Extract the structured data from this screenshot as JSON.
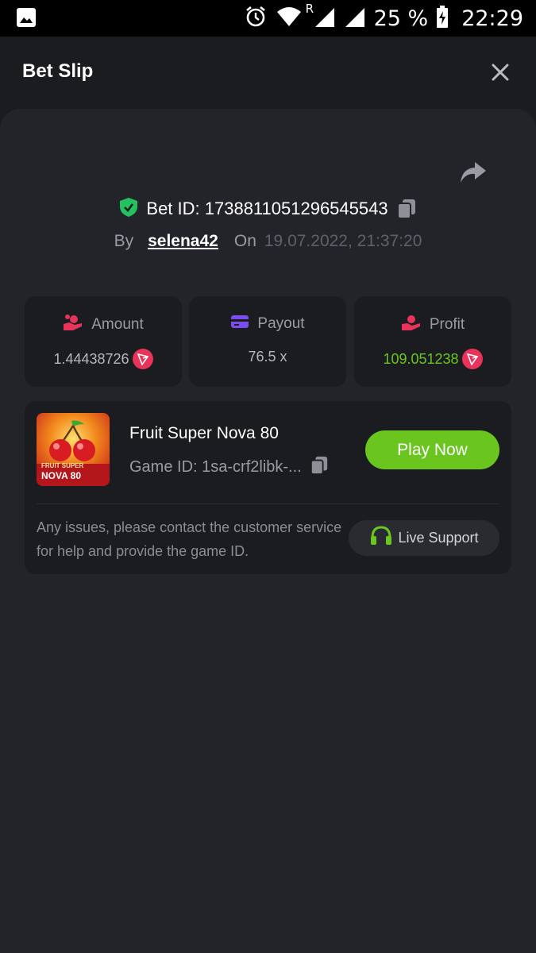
{
  "status_bar": {
    "battery": "25 %",
    "time": "22:29",
    "signal_roaming": "R"
  },
  "header": {
    "title": "Bet Slip"
  },
  "bet": {
    "id_text": "Bet ID: 1738811051296545543",
    "by_label": "By",
    "user": "selena42",
    "on_label": "On",
    "date": "19.07.2022, 21:37:20"
  },
  "stats": {
    "amount": {
      "label": "Amount",
      "value": "1.44438726",
      "icon": "coins-hand-icon"
    },
    "payout": {
      "label": "Payout",
      "value": "76.5 x",
      "icon": "card-icon"
    },
    "profit": {
      "label": "Profit",
      "value": "109.051238",
      "icon": "money-hand-icon"
    }
  },
  "game": {
    "title": "Fruit Super Nova 80",
    "game_id": "Game ID: 1sa-crf2libk-...",
    "play_label": "Play Now",
    "thumb_caption_1": "FRUIT SUPER",
    "thumb_caption_2": "NOVA 80",
    "help_text": "Any issues, please contact the customer service for help and provide the game ID.",
    "support_label": "Live Support"
  },
  "colors": {
    "accent_green": "#6ac51f",
    "tron_red": "#e8345a",
    "payout_purple": "#7b4cf0"
  }
}
